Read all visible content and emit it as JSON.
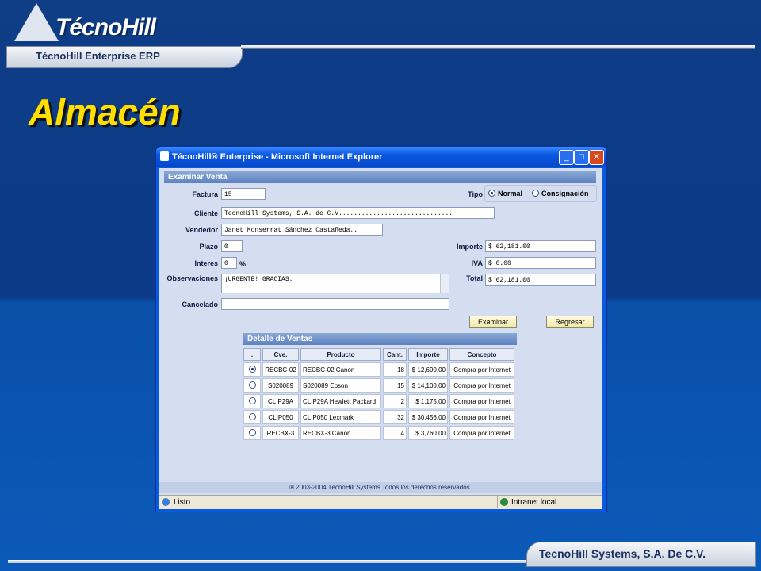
{
  "brand": {
    "logo": "TécnoHill",
    "erp_label": "TécnoHill Enterprise ERP",
    "footer": "TecnoHill Systems, S.A. De C.V."
  },
  "page_title": "Almacén",
  "window": {
    "title": "TécnoHill® Enterprise - Microsoft Internet Explorer",
    "controls": [
      "_",
      "□",
      "✕"
    ]
  },
  "form": {
    "header": "Examinar Venta",
    "factura_label": "Factura",
    "factura": "15",
    "tipo_label": "Tipo",
    "tipo_options": [
      "Normal",
      "Consignación"
    ],
    "tipo_selected": "Normal",
    "cliente_label": "Cliente",
    "cliente": "TecnoHill Systems, S.A. de C.V..............................",
    "vendedor_label": "Vendedor",
    "vendedor": "Janet Monserrat Sánchez Castañeda..",
    "plazo_label": "Plazo",
    "plazo": "0",
    "interes_label": "Interes",
    "interes": "0",
    "interes_unit": "%",
    "importe_label": "Importe",
    "importe": "$ 62,181.00",
    "iva_label": "IVA",
    "iva": "$ 0.00",
    "total_label": "Total",
    "total": "$ 62,181.00",
    "observaciones_label": "Observaciones",
    "observaciones": "¡URGENTE! GRACIAS.",
    "cancelado_label": "Cancelado",
    "cancelado": "",
    "examinar_button": "Examinar",
    "regresar_button": "Regresar"
  },
  "detalle": {
    "header": "Detalle de Ventas",
    "columns": [
      ".",
      "Cve.",
      "Producto",
      "Cant.",
      "Importe",
      "Concepto"
    ],
    "rows": [
      {
        "selected": true,
        "cve": "RECBC-02",
        "producto": "RECBC-02 Canon",
        "cant": "18",
        "importe": "$ 12,690.00",
        "concepto": "Compra por Internet"
      },
      {
        "selected": false,
        "cve": "S020089",
        "producto": "S020089 Epson",
        "cant": "15",
        "importe": "$ 14,100.00",
        "concepto": "Compra por Internet"
      },
      {
        "selected": false,
        "cve": "CLIP29A",
        "producto": "CLIP29A Hewlett Packard",
        "cant": "2",
        "importe": "$ 1,175.00",
        "concepto": "Compra por Internet"
      },
      {
        "selected": false,
        "cve": "CLIP050",
        "producto": "CLIP050 Lexmark",
        "cant": "32",
        "importe": "$ 30,456.00",
        "concepto": "Compra por Internet"
      },
      {
        "selected": false,
        "cve": "RECBX-3",
        "producto": "RECBX-3 Canon",
        "cant": "4",
        "importe": "$ 3,760.00",
        "concepto": "Compra por Internet"
      }
    ]
  },
  "copyright": "® 2003-2004 TécnoHill Systems Todos los derechos reservados.",
  "statusbar": {
    "left": "Listo",
    "right": "Intranet local"
  }
}
